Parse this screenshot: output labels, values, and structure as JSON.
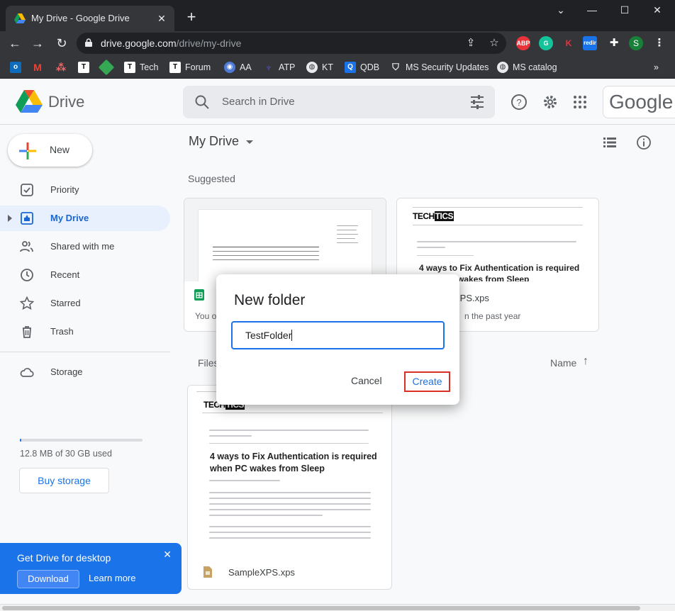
{
  "browser": {
    "tab_title": "My Drive - Google Drive",
    "url_host": "drive.google.com",
    "url_path": "/drive/my-drive",
    "profile_initial": "S",
    "ext_abp": "ABP",
    "ext_k": "K",
    "ext_redir": "redir",
    "bookmarks": [
      "Tech",
      "Forum",
      "AA",
      "ATP",
      "KT",
      "QDB",
      "MS Security Updates",
      "MS catalog"
    ],
    "bookmark_icons": [
      "T",
      "T",
      "T"
    ]
  },
  "drive": {
    "app_name": "Drive",
    "search_placeholder": "Search in Drive",
    "google_badge": "Google",
    "new_label": "New",
    "nav": {
      "priority": "Priority",
      "my_drive": "My Drive",
      "shared": "Shared with me",
      "recent": "Recent",
      "starred": "Starred",
      "trash": "Trash",
      "storage": "Storage"
    },
    "storage_used_text": "12.8 MB of 30 GB used",
    "storage_fraction": 0.0004,
    "buy_storage": "Buy storage",
    "promo": {
      "title": "Get Drive for desktop",
      "download": "Download",
      "learn_more": "Learn more"
    },
    "main_title": "My Drive",
    "suggested_label": "Suggested",
    "files_label": "Files",
    "sort_label": "Name",
    "suggested_cards": [
      {
        "subtitle_fragment": "You o"
      },
      {
        "name_fragment": "XPS.xps",
        "subtitle_fragment": "n the past year",
        "doc_heading": "4 ways to Fix Authentication is required when PC wakes from Sleep"
      }
    ],
    "file_cards": [
      {
        "name": "SampleXPS.xps",
        "doc_heading": "4 ways to Fix Authentication is required when PC wakes from Sleep"
      }
    ],
    "logo_text_a": "TECH",
    "logo_text_b": "TICS"
  },
  "dialog": {
    "title": "New folder",
    "input_value": "TestFolder",
    "cancel": "Cancel",
    "create": "Create"
  },
  "colors": {
    "accent": "#1a73e8",
    "highlight_border": "#d93025",
    "chrome_dark": "#202124"
  }
}
